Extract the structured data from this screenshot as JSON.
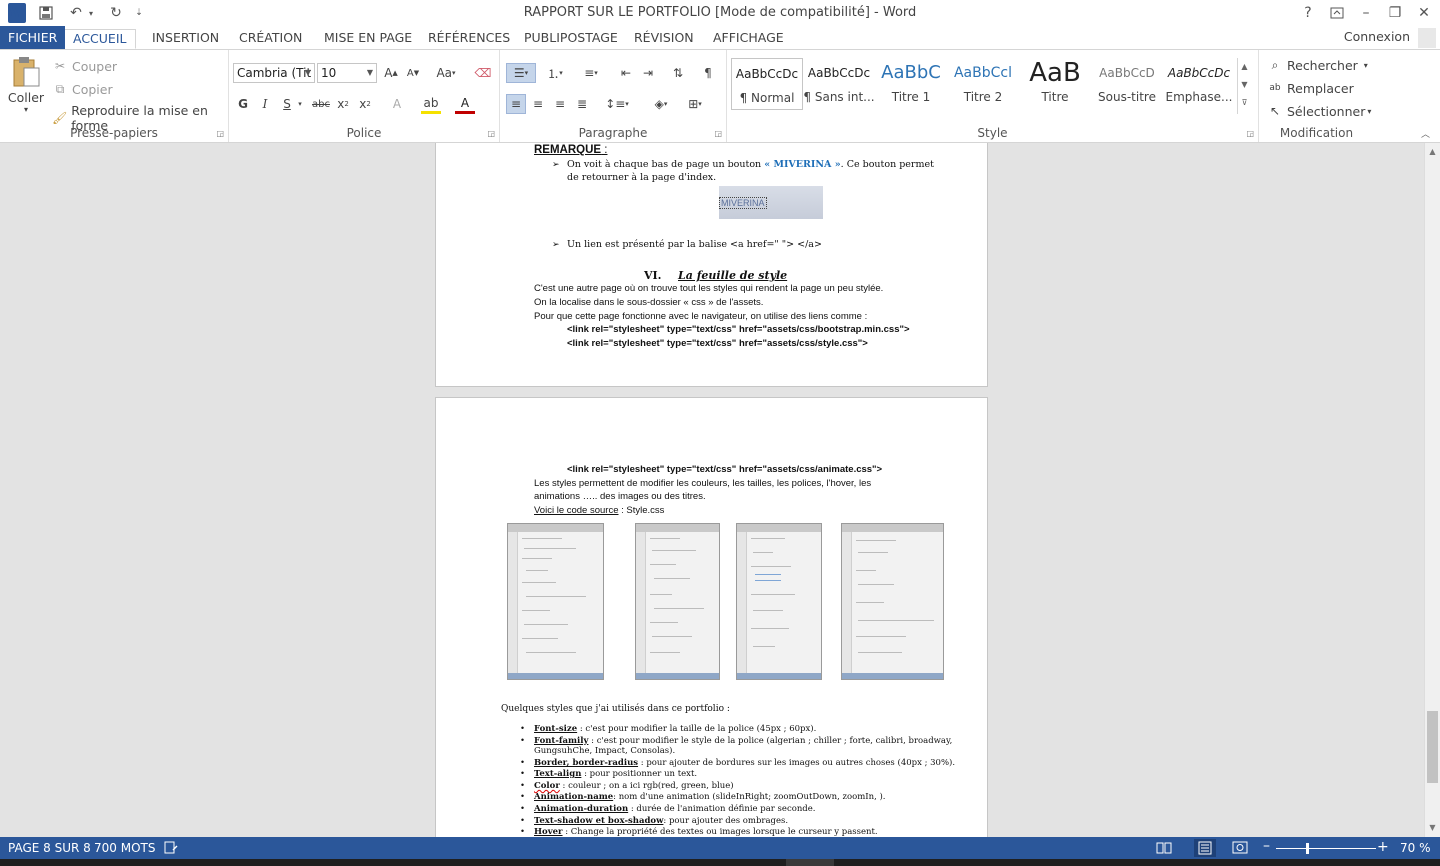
{
  "window": {
    "title": "RAPPORT SUR LE PORTFOLIO [Mode de compatibilité] - Word",
    "help": "?",
    "minimize": "–",
    "restore": "❐",
    "close": "✕"
  },
  "quick_access": {
    "word_logo": "W"
  },
  "tabs": {
    "file": "FICHIER",
    "items": [
      "ACCUEIL",
      "INSERTION",
      "CRÉATION",
      "MISE EN PAGE",
      "RÉFÉRENCES",
      "PUBLIPOSTAGE",
      "RÉVISION",
      "AFFICHAGE"
    ],
    "active": "ACCUEIL",
    "account": "Connexion"
  },
  "ribbon": {
    "clipboard": {
      "label": "Presse-papiers",
      "paste": "Coller",
      "cut": "Couper",
      "copy": "Copier",
      "format_painter": "Reproduire la mise en forme"
    },
    "font": {
      "label": "Police",
      "font_name": "Cambria (Tit",
      "font_size": "10"
    },
    "paragraph": {
      "label": "Paragraphe"
    },
    "styles": {
      "label": "Style",
      "items": [
        {
          "preview": "AaBbCcDc",
          "name": "¶ Normal"
        },
        {
          "preview": "AaBbCcDc",
          "name": "¶ Sans int..."
        },
        {
          "preview": "AaBbC",
          "name": "Titre 1"
        },
        {
          "preview": "AaBbCcl",
          "name": "Titre 2"
        },
        {
          "preview": "AaB",
          "name": "Titre"
        },
        {
          "preview": "AaBbCcD",
          "name": "Sous-titre"
        },
        {
          "preview": "AaBbCcDc",
          "name": "Emphase..."
        }
      ]
    },
    "editing": {
      "label": "Modification",
      "find": "Rechercher",
      "replace": "Remplacer",
      "select": "Sélectionner"
    }
  },
  "document": {
    "page1": {
      "remarque": "REMARQUE",
      "remarque_colon": " :",
      "bullet1_a": "On voit à chaque bas de page un bouton ",
      "bullet1_link": "« MIVERINA »",
      "bullet1_b": ". Ce bouton permet",
      "bullet1_c": "de retourner à la page d'index.",
      "button_label": "MIVERINA",
      "bullet2": "Un lien est présenté par la balise  <a href=\" \"> </a>",
      "section_num": "VI.",
      "section_title": "La feuille de style",
      "p1": "C'est une autre page où on trouve tout les styles qui rendent  la page un peu stylée.",
      "p2": "On la localise dans le sous-dossier « css » de l'assets.",
      "p3": "Pour que cette page fonctionne avec le navigateur, on utilise des liens comme :",
      "code1": "<link rel=\"stylesheet\" type=\"text/css\" href=\"assets/css/bootstrap.min.css\">",
      "code2": "<link rel=\"stylesheet\" type=\"text/css\" href=\"assets/css/style.css\">"
    },
    "page2": {
      "code3": "<link rel=\"stylesheet\" type=\"text/css\" href=\"assets/css/animate.css\">",
      "p4a": "Les styles permettent de modifier les couleurs, les tailles, les polices, l'hover, les",
      "p4b": "animations ….. des images ou des titres.",
      "source_link": "Voici le code source",
      "source_rest": " : Style.css",
      "styles_intro": "Quelques styles que j'ai utilisés dans ce portfolio :",
      "list": [
        {
          "term": "Font-size",
          "desc": " : c'est pour modifier la taille de la police (45px ; 60px)."
        },
        {
          "term": "Font-family",
          "desc": " : c'est pour modifier le style  de la police (algerian ; chiller ; forte, calibri, broadway,"
        },
        {
          "term": "",
          "desc": "GungsuhChe, Impact, Consolas)."
        },
        {
          "term": "Border,  border-radius",
          "desc": " : pour ajouter de bordures sur les images ou autres choses (40px ; 30%)."
        },
        {
          "term": "Text-align",
          "desc": " : pour positionner un text."
        },
        {
          "term": "Color",
          "desc": " : couleur ; on a ici rgb(red, green, blue)"
        },
        {
          "term": "Animation-name",
          "desc": ": nom d'une animation (slideInRight; zoomOutDown, zoomIn, )."
        },
        {
          "term": "Animation-duration",
          "desc": " : durée de l'animation définie par seconde."
        },
        {
          "term": "Text-shadow et box-shadow",
          "desc": ": pour ajouter des ombrages."
        },
        {
          "term": "Hover",
          "desc": " : Change la propriété des textes ou images lorsque le curseur y passent."
        }
      ]
    }
  },
  "status": {
    "page": "PAGE 8 SUR 8",
    "words": "700 MOTS",
    "zoom": "70 %",
    "zoom_minus": "–",
    "zoom_plus": "+"
  },
  "colors": {
    "accent": "#2b579a",
    "link": "#1f6fb8"
  }
}
